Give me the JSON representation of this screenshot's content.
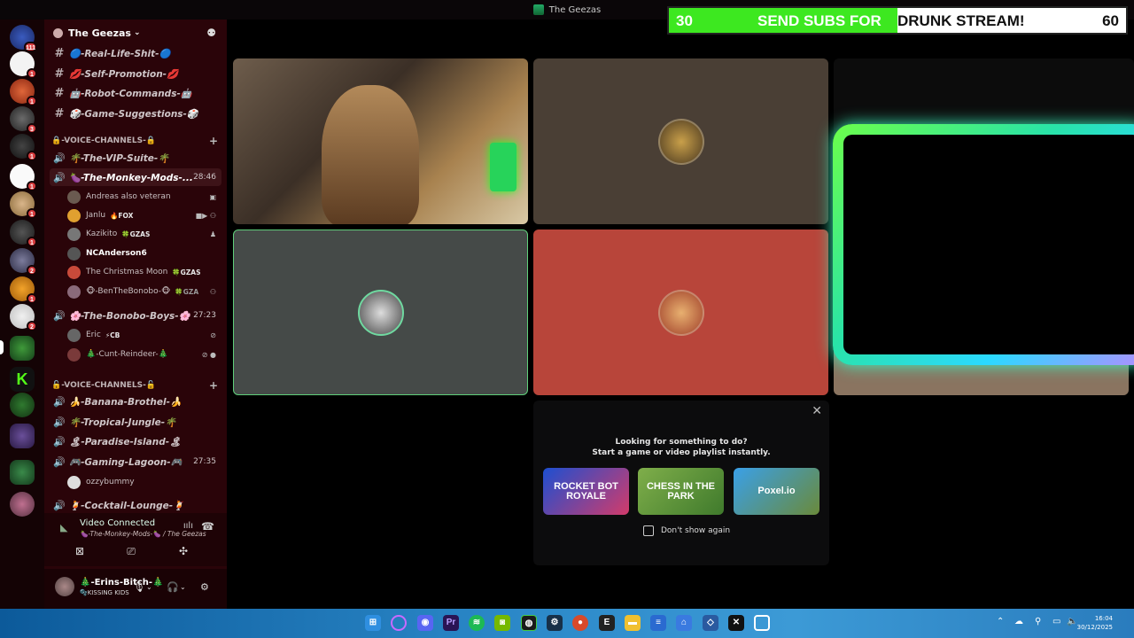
{
  "window": {
    "title": "The Geezas"
  },
  "banner": {
    "left_count": "30",
    "message_a": "SEND SUBS FOR",
    "message_b": "DRUNK STREAM!",
    "right_count": "60",
    "progress": 0.5,
    "fill_color": "#3de820"
  },
  "rail": {
    "badges": [
      "111",
      "1",
      "1",
      "3",
      "1",
      "1",
      "1",
      "1",
      "2",
      "1",
      "2"
    ]
  },
  "server": {
    "name": "The Geezas"
  },
  "channels": [
    {
      "type": "text",
      "label": "🔵-Real-Life-Shit-🔵"
    },
    {
      "type": "text",
      "label": "💋-Self-Promotion-💋"
    },
    {
      "type": "text",
      "label": "🤖-Robot-Commands-🤖"
    },
    {
      "type": "text",
      "label": "🎲-Game-Suggestions-🎲"
    }
  ],
  "voice_category_1": "🔒-VOICE-CHANNELS-🔒",
  "voice_channels_1": [
    {
      "label": "🌴-The-VIP-Suite-🌴",
      "time": ""
    },
    {
      "label": "🍆-The-Monkey-Mods-...",
      "time": "28:46"
    }
  ],
  "monkey_members": [
    {
      "name": "Andreas also veteran",
      "tag": ""
    },
    {
      "name": "Janlu",
      "tag": "🔥FOX"
    },
    {
      "name": "Kazikito",
      "tag": "🍀GZAS"
    },
    {
      "name": "NCAnderson6",
      "tag": ""
    },
    {
      "name": "The Christmas Moon",
      "tag": "🍀GZAS"
    },
    {
      "name": "🐵-BenTheBonobo-🐵",
      "tag": "🍀GZA"
    }
  ],
  "bonobo": {
    "label": "🌸-The-Bonobo-Boys-🌸",
    "time": "27:23"
  },
  "bonobo_members": [
    {
      "name": "Eric",
      "tag": "⚡CB"
    },
    {
      "name": "🎄-Cunt-Reindeer-🎄",
      "tag": ""
    }
  ],
  "voice_category_2": "🔓-VOICE-CHANNELS-🔓",
  "voice_channels_2": [
    {
      "label": "🍌-Banana-Brothel-🍌",
      "time": ""
    },
    {
      "label": "🌴-Tropical-Jungle-🌴",
      "time": ""
    },
    {
      "label": "🏝-Paradise-Island-🏝",
      "time": ""
    },
    {
      "label": "🎮-Gaming-Lagoon-🎮",
      "time": "27:35"
    }
  ],
  "lagoon_members": [
    {
      "name": "ozzybummy"
    }
  ],
  "cocktail": {
    "label": "🍹-Cocktail-Lounge-🍹"
  },
  "voice_panel": {
    "status": "Video Connected",
    "subtitle": "🍆-The-Monkey-Mods-🍆 / The Geezas"
  },
  "user": {
    "name": "🎄-Erins-Bitch-🎄",
    "status": "🫧KISSING KIDS"
  },
  "activity": {
    "line1": "Looking for something to do?",
    "line2": "Start a game or video playlist instantly.",
    "games": [
      "ROCKET BOT ROYALE",
      "CHESS IN THE PARK",
      "Poxel.io"
    ],
    "checkbox_label": "Don't show again"
  },
  "clock": {
    "time": "16:04",
    "date": "30/12/2025"
  },
  "colors": {
    "sidebar": "#2a0409",
    "accent_green": "#3de820"
  }
}
